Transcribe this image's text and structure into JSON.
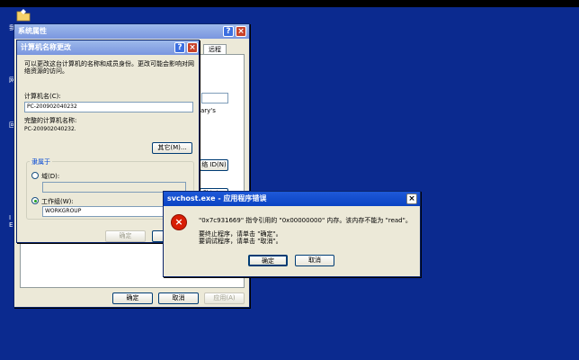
{
  "sysprops": {
    "title": "系统属性",
    "tab_remote": "远程",
    "frag_arys": "ary's",
    "frag_id": "络 ID(N)",
    "frag_change": "改(C)...",
    "ok": "确定",
    "cancel": "取消",
    "apply": "应用(A)"
  },
  "namechange": {
    "title": "计算机名称更改",
    "description": "可以更改这台计算机的名称和成员身份。更改可能会影响对网络资源的访问。",
    "computer_name_label": "计算机名(C):",
    "computer_name_value": "PC-200902040232",
    "full_name_label": "完整的计算机名称:",
    "full_name_value": "PC-200902040232.",
    "more_button": "其它(M)...",
    "member_of_group": "隶属于",
    "domain_label": "域(D):",
    "workgroup_label": "工作组(W):",
    "workgroup_value": "WORKGROUP",
    "ok": "确定"
  },
  "error": {
    "title": "svchost.exe - 应用程序错误",
    "message1": "\"0x7c931669\" 指令引用的 \"0x00000000\" 内存。该内存不能为 \"read\"。",
    "message2": "要终止程序，请单击 \"确定\"。",
    "message3": "要调试程序，请单击 \"取消\"。",
    "ok": "确定",
    "cancel": "取消"
  },
  "desktop_left_chars": [
    "我",
    "网",
    "回",
    "I",
    "E"
  ]
}
